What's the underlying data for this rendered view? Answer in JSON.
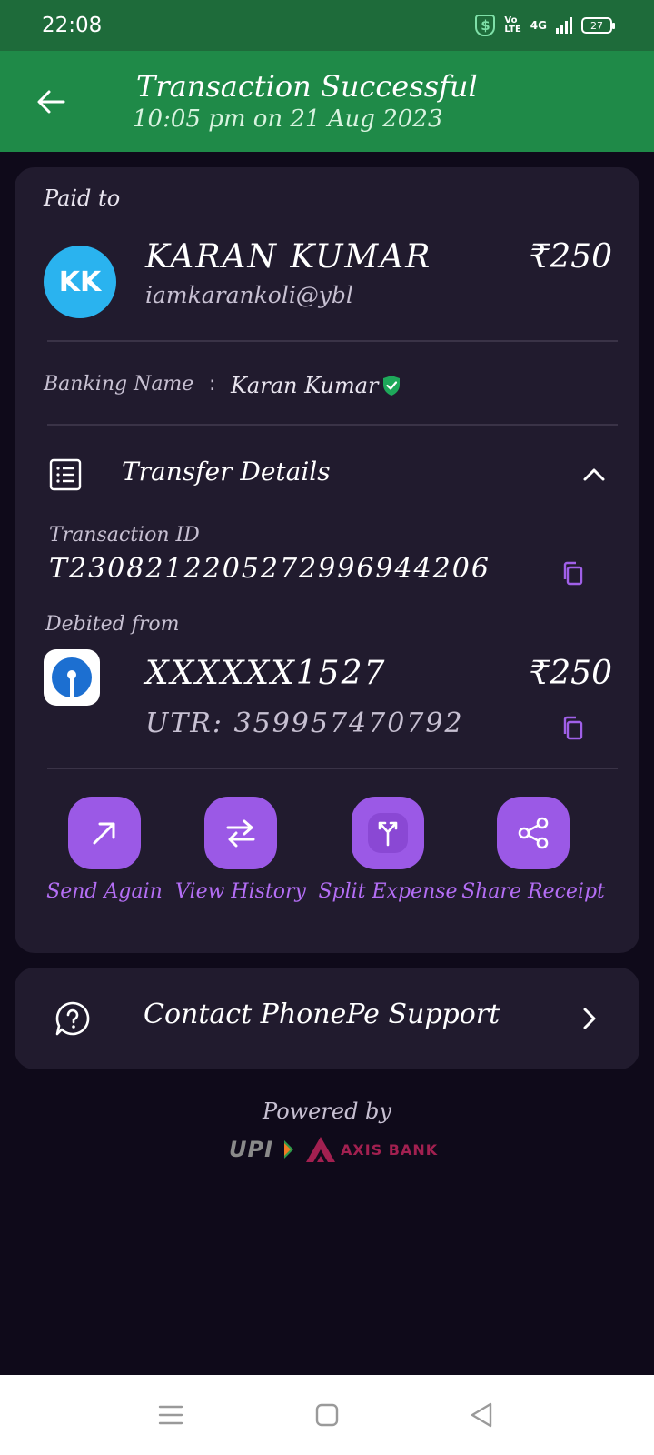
{
  "status_bar": {
    "time": "22:08",
    "volte": "Vo LTE",
    "network": "4G",
    "battery": "27"
  },
  "header": {
    "title": "Transaction Successful",
    "subtitle": "10:05 pm on 21 Aug 2023"
  },
  "payment": {
    "paid_to_label": "Paid to",
    "avatar_initials": "KK",
    "payee_name": "KARAN KUMAR",
    "payee_upi": "iamkarankoli@ybl",
    "amount": "₹250",
    "banking_name_label": "Banking Name",
    "banking_name_sep": ":",
    "banking_name_value": "Karan Kumar"
  },
  "transfer": {
    "title": "Transfer Details",
    "txn_id_label": "Transaction ID",
    "txn_id_value": "T2308212205272996944206",
    "debited_from_label": "Debited from",
    "account_masked": "XXXXXX1527",
    "debit_amount": "₹250",
    "utr": "UTR: 359957470792"
  },
  "actions": [
    {
      "label": "Send Again",
      "icon": "arrow-up-right-icon"
    },
    {
      "label": "View History",
      "icon": "swap-arrows-icon"
    },
    {
      "label": "Split Expense",
      "icon": "split-icon"
    },
    {
      "label": "Share Receipt",
      "icon": "share-icon"
    }
  ],
  "support": {
    "label": "Contact PhonePe Support"
  },
  "footer": {
    "powered_by": "Powered by",
    "upi": "UPI",
    "bank": "AXIS BANK"
  },
  "colors": {
    "header_green": "#1f8a48",
    "status_green": "#1e6b3a",
    "accent_purple": "#9b59e6",
    "card_bg": "#211b2e",
    "page_bg": "#0f0a1a",
    "avatar_blue": "#2ab3ef"
  }
}
